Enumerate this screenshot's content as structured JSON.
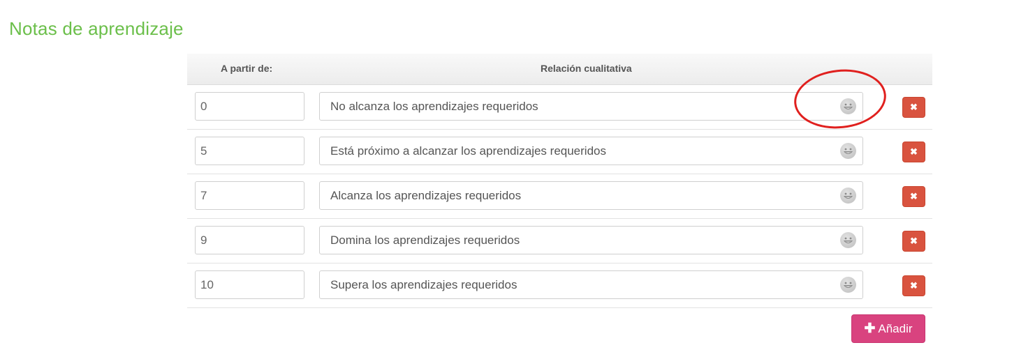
{
  "section": {
    "title": "Notas de aprendizaje"
  },
  "table": {
    "headers": {
      "from": "A partir de:",
      "relation": "Relación cualitativa"
    },
    "rows": [
      {
        "from": "0",
        "relation": "No alcanza los aprendizajes requeridos"
      },
      {
        "from": "5",
        "relation": "Está próximo a alcanzar los aprendizajes requeridos"
      },
      {
        "from": "7",
        "relation": "Alcanza los aprendizajes requeridos"
      },
      {
        "from": "9",
        "relation": "Domina los aprendizajes requeridos"
      },
      {
        "from": "10",
        "relation": "Supera los aprendizajes requeridos"
      }
    ],
    "row_icon": "grinning-face-icon",
    "delete_icon": "times-icon",
    "delete_glyph": "✖"
  },
  "actions": {
    "add_label": "Añadir",
    "add_icon": "plus-icon",
    "add_glyph": "✚"
  },
  "annotation": {
    "shape": "ellipse",
    "target": "emoji picker in first row",
    "color": "#e0201e"
  },
  "colors": {
    "title": "#6bbf4a",
    "delete_button": "#d9533f",
    "add_button": "#d9437f"
  }
}
